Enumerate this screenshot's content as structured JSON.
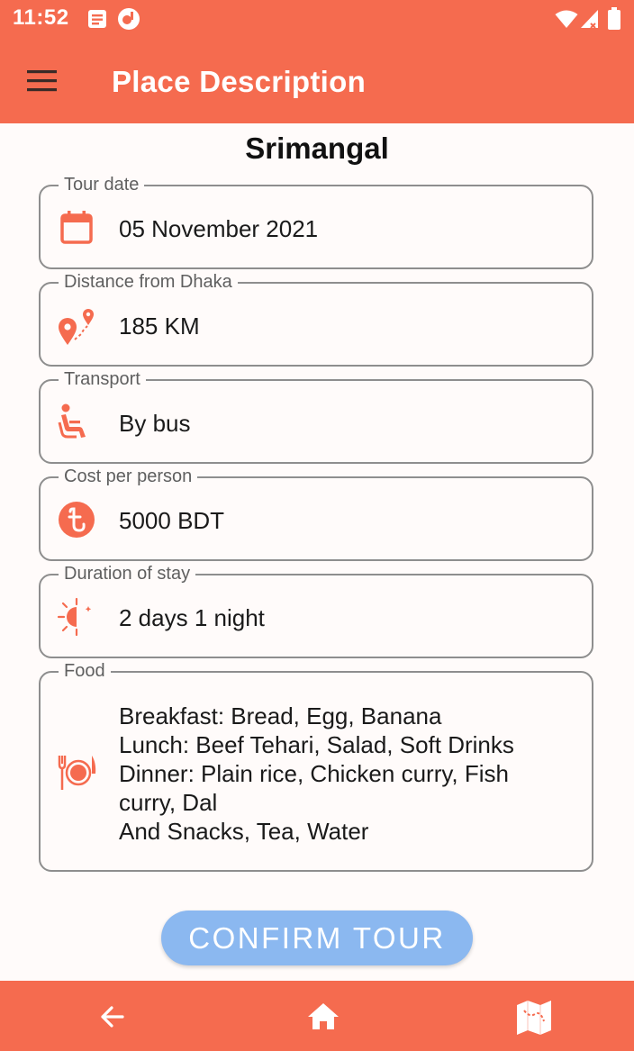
{
  "status_bar": {
    "time": "11:52",
    "icons": [
      "notes-icon",
      "app-icon",
      "wifi-icon",
      "signal-icon",
      "battery-icon"
    ]
  },
  "app_bar": {
    "title": "Place Description",
    "menu_icon": "hamburger-menu-icon"
  },
  "place": {
    "name": "Srimangal"
  },
  "fields": {
    "tour_date": {
      "label": "Tour date",
      "value": "05 November 2021",
      "icon": "calendar-icon"
    },
    "distance": {
      "label": "Distance from Dhaka",
      "value": "185 KM",
      "icon": "route-pin-icon"
    },
    "transport": {
      "label": "Transport",
      "value": "By bus",
      "icon": "seat-icon"
    },
    "cost": {
      "label": "Cost per person",
      "value": "5000 BDT",
      "icon": "taka-coin-icon"
    },
    "duration": {
      "label": "Duration of stay",
      "value": "2 days 1 night",
      "icon": "day-night-icon"
    },
    "food": {
      "label": "Food",
      "icon": "dining-icon",
      "lines": [
        "Breakfast: Bread, Egg, Banana",
        "Lunch: Beef Tehari, Salad, Soft Drinks",
        "Dinner: Plain rice, Chicken curry, Fish curry, Dal",
        "And Snacks, Tea, Water"
      ]
    }
  },
  "confirm_button": {
    "label": "CONFIRM TOUR"
  },
  "bottom_nav": {
    "items": [
      "back-arrow-icon",
      "home-icon",
      "map-icon"
    ]
  },
  "colors": {
    "primary": "#f56b4f",
    "button": "#8bb8f0",
    "border": "#8e8e8e",
    "background": "#fffbfa"
  }
}
